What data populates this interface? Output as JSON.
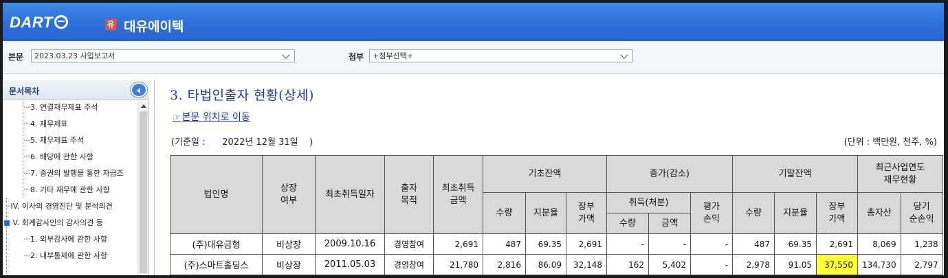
{
  "header": {
    "logo_text": "DART",
    "company_badge": "유",
    "company_name": "대유에이텍"
  },
  "selectors": {
    "main_label": "본문",
    "main_value": "2023.03.23  사업보고서",
    "attach_label": "첨부",
    "attach_value": "+첨부선택+"
  },
  "sidebar": {
    "title": "문서목차",
    "items": [
      {
        "prefix": "····",
        "label": "3. 연결재무제표 주석"
      },
      {
        "prefix": "····",
        "label": "4. 재무제표"
      },
      {
        "prefix": "····",
        "label": "5. 재무제표 주석"
      },
      {
        "prefix": "····",
        "label": "6. 배당에 관한 사항"
      },
      {
        "prefix": "····",
        "label": "7. 증권의 발행을 통한 자금조"
      },
      {
        "prefix": "····",
        "label": "8. 기타 재무에 관한 사항"
      },
      {
        "prefix": "···",
        "label": "IV. 이사의 경영진단 및 분석의견"
      },
      {
        "prefix": "·",
        "label": "V. 회계감사인의 감사의견 등"
      },
      {
        "prefix": "····",
        "label": "1. 외부감사에 관한 사항"
      },
      {
        "prefix": "····",
        "label": "2. 내부통제에 관한 사항"
      }
    ]
  },
  "main": {
    "section_title": "3. 타법인출자 현황(상세)",
    "back_link": "본문 위치로 이동",
    "base_date": "(기준일 :      2022년 12월 31일    )",
    "unit": "(단위 : 백만원, 천주, %)",
    "table": {
      "headers": {
        "corp_name": "법인명",
        "listed": "상장\n여부",
        "first_date": "최초취득일자",
        "purpose": "출자\n목적",
        "first_amount": "최초취득\n금액",
        "beginning": "기초잔액",
        "change": "증가(감소)",
        "ending": "기말잔액",
        "recent": "최근사업연도\n재무현황",
        "qty": "수량",
        "share": "지분율",
        "book": "장부\n가액",
        "acq": "취득(처분)",
        "eval": "평가\n손익",
        "acq_qty": "수량",
        "acq_amt": "금액",
        "total_assets": "총자산",
        "net_income": "당기\n순손익"
      },
      "rows": [
        {
          "name": "(주)대유금형",
          "listed": "비상장",
          "date": "2009.10.16",
          "purpose": "경영참여",
          "first_amount": "2,691",
          "b_qty": "487",
          "b_share": "69.35",
          "b_book": "2,691",
          "c_qty": "-",
          "c_amt": "-",
          "c_eval": "-",
          "e_qty": "487",
          "e_share": "69.35",
          "e_book": "2,691",
          "assets": "8,069",
          "income": "1,238"
        },
        {
          "name": "(주)스마트홀딩스",
          "listed": "비상장",
          "date": "2011.05.03",
          "purpose": "경영참여",
          "first_amount": "21,780",
          "b_qty": "2,816",
          "b_share": "86.09",
          "b_book": "32,148",
          "c_qty": "162",
          "c_amt": "5,402",
          "c_eval": "-",
          "e_qty": "2,978",
          "e_share": "91.05",
          "e_book": "37,550",
          "assets": "134,730",
          "income": "2,797"
        }
      ],
      "highlight_color": "#ffff33"
    }
  },
  "colors": {
    "header_blue": "#2d6fd9",
    "title_blue": "#1e3aa0",
    "table_header_gray": "#d9d9d9"
  }
}
